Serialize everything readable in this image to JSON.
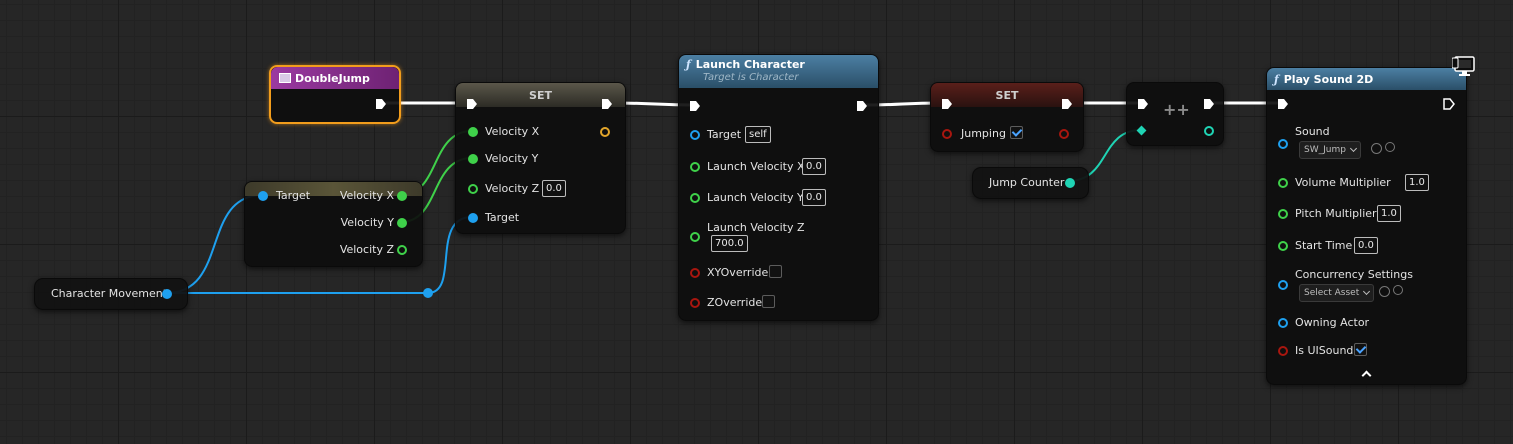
{
  "colors": {
    "exec": "#ffffff",
    "float": "#3fd14a",
    "object": "#1ea0ef",
    "bool": "#a8160f",
    "int": "#1fd4b4",
    "event_header": "#8a2c8e",
    "set_header": "#4a4a3a",
    "function_header": "#3c6a8c",
    "selection": "#f29d1c"
  },
  "event_node": {
    "title": "DoubleJump",
    "icon": "event-icon"
  },
  "break_struct": {
    "target_label": "Target",
    "vx_label": "Velocity X",
    "vy_label": "Velocity Y",
    "vz_label": "Velocity Z"
  },
  "character_movement": {
    "label": "Character Movement"
  },
  "set_velocity": {
    "title": "SET",
    "vx_label": "Velocity X",
    "vy_label": "Velocity Y",
    "vz_label": "Velocity Z",
    "vz_value": "0.0",
    "target_label": "Target"
  },
  "launch_character": {
    "title": "Launch Character",
    "subtitle": "Target is Character",
    "target_label": "Target",
    "target_value": "self",
    "lvx_label": "Launch Velocity X",
    "lvx_value": "0.0",
    "lvy_label": "Launch Velocity Y",
    "lvy_value": "0.0",
    "lvz_label": "Launch Velocity Z",
    "lvz_value": "700.0",
    "xy_override_label": "XYOverride",
    "xy_override_checked": false,
    "z_override_label": "ZOverride",
    "z_override_checked": false
  },
  "set_jumping": {
    "title": "SET",
    "jumping_label": "Jumping",
    "jumping_checked": true
  },
  "increment": {
    "symbol": "++"
  },
  "jump_counter": {
    "label": "Jump Counter"
  },
  "play_sound": {
    "title": "Play Sound 2D",
    "sound_label": "Sound",
    "sound_value": "SW_Jump",
    "volume_label": "Volume Multiplier",
    "volume_value": "1.0",
    "pitch_label": "Pitch Multiplier",
    "pitch_value": "1.0",
    "start_label": "Start Time",
    "start_value": "0.0",
    "concurrency_label": "Concurrency Settings",
    "concurrency_value": "Select Asset",
    "owner_label": "Owning Actor",
    "uisound_label": "Is UISound",
    "uisound_checked": true
  }
}
